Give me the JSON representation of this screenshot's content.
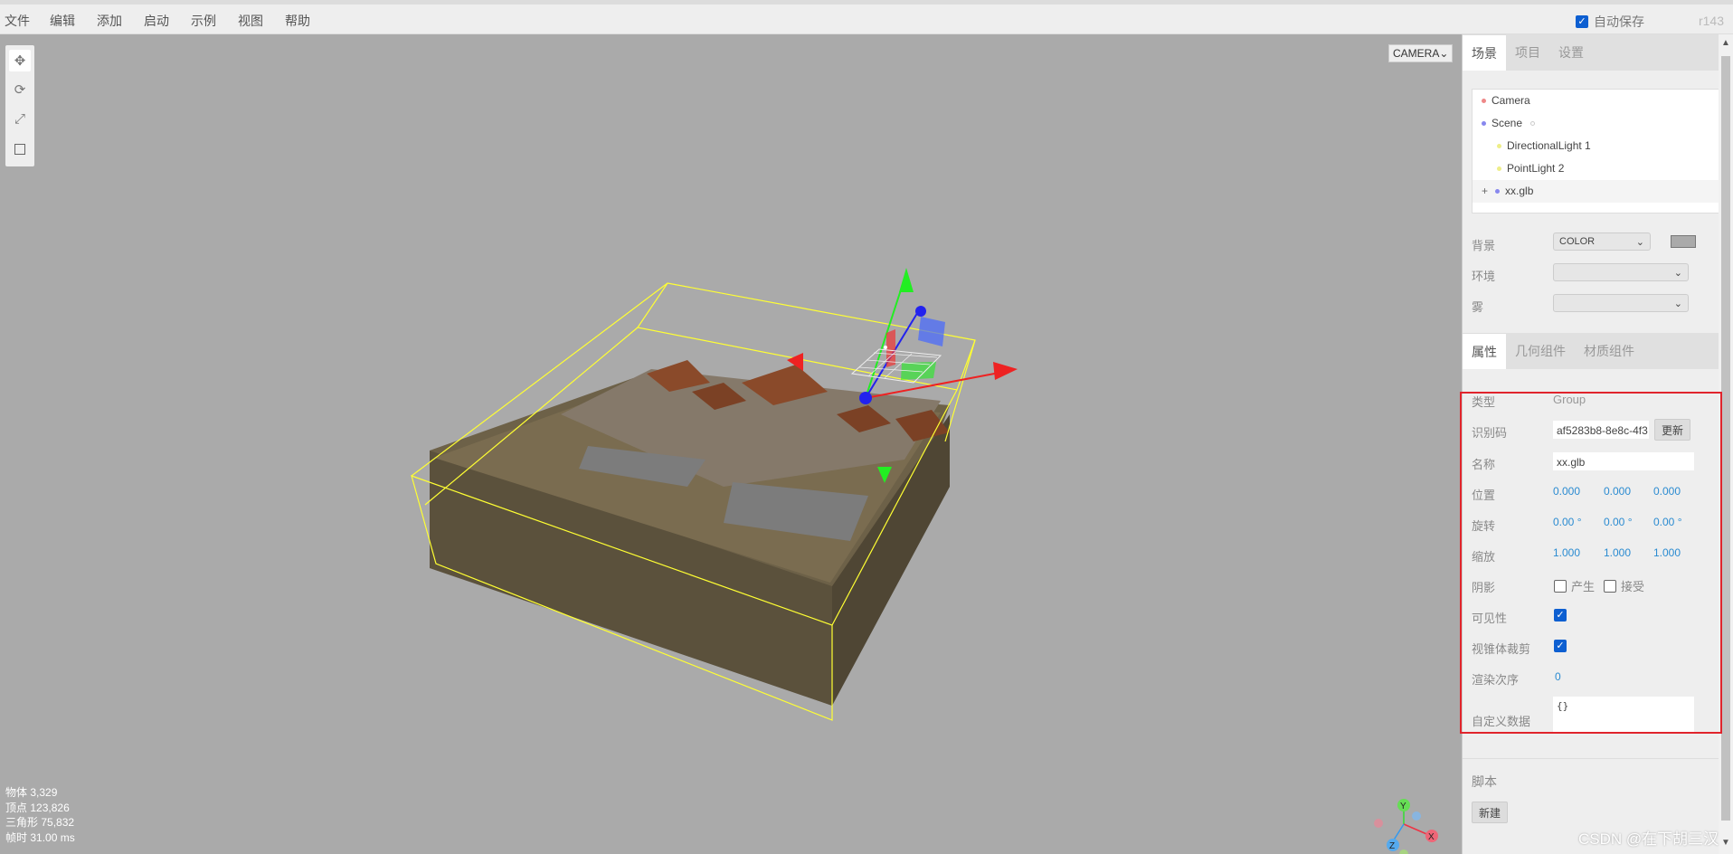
{
  "menubar": {
    "items": [
      "文件",
      "编辑",
      "添加",
      "启动",
      "示例",
      "视图",
      "帮助"
    ],
    "autosave_label": "自动保存",
    "autosave_checked": true,
    "version": "r143"
  },
  "viewport": {
    "camera_select": "CAMERA",
    "info": {
      "objects_label": "物体",
      "objects_value": "3,329",
      "vertices_label": "顶点",
      "vertices_value": "123,826",
      "triangles_label": "三角形",
      "triangles_value": "75,832",
      "frametime_label": "帧时",
      "frametime_value": "31.00 ms"
    },
    "axes": {
      "x": "X",
      "y": "Y",
      "z": "Z"
    }
  },
  "sidebar": {
    "main_tabs": [
      "场景",
      "项目",
      "设置"
    ],
    "outliner": [
      {
        "name": "Camera",
        "color": "#e88"
      },
      {
        "name": "Scene",
        "color": "#88e"
      },
      {
        "name": "DirectionalLight 1",
        "color": "#ee8"
      },
      {
        "name": "PointLight 2",
        "color": "#ee8"
      },
      {
        "name": "xx.glb",
        "color": "#88e",
        "expander": "+"
      }
    ],
    "scene": {
      "background_label": "背景",
      "background_value": "COLOR",
      "background_color": "#aaaaaa",
      "environment_label": "环境",
      "fog_label": "雾"
    },
    "prop_tabs": [
      "属性",
      "几何组件",
      "材质组件"
    ],
    "object": {
      "type_label": "类型",
      "type_value": "Group",
      "uuid_label": "识别码",
      "uuid_value": "af5283b8-8e8c-4f3",
      "uuid_button": "更新",
      "name_label": "名称",
      "name_value": "xx.glb",
      "position_label": "位置",
      "position": [
        "0.000",
        "0.000",
        "0.000"
      ],
      "rotation_label": "旋转",
      "rotation": [
        "0.00 °",
        "0.00 °",
        "0.00 °"
      ],
      "scale_label": "缩放",
      "scale": [
        "1.000",
        "1.000",
        "1.000"
      ],
      "shadow_label": "阴影",
      "shadow_cast": "产生",
      "shadow_receive": "接受",
      "visible_label": "可见性",
      "frustum_label": "视锥体裁剪",
      "render_order_label": "渲染次序",
      "render_order": "0",
      "userdata_label": "自定义数据",
      "userdata": "{}"
    },
    "script": {
      "label": "脚本",
      "new_button": "新建"
    }
  },
  "watermark": "CSDN @在下胡三汉"
}
